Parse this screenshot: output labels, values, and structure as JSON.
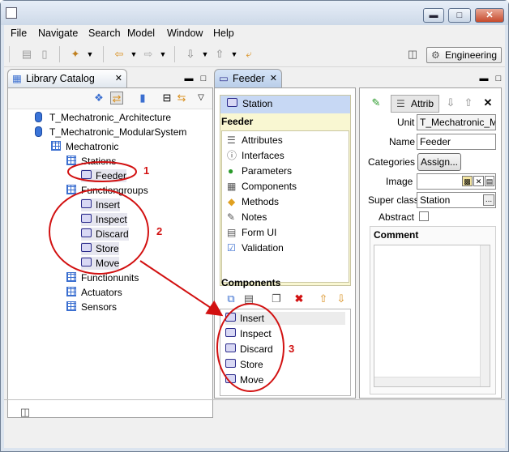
{
  "menu": [
    "File",
    "Navigate",
    "Search",
    "Model",
    "Window",
    "Help"
  ],
  "perspective": {
    "label": "Engineering"
  },
  "library": {
    "tab_label": "Library Catalog",
    "items": [
      {
        "label": "T_Mechatronic_Architecture"
      },
      {
        "label": "T_Mechatronic_ModularSystem"
      },
      {
        "label": "Mechatronic"
      },
      {
        "label": "Stations"
      },
      {
        "label": "Feeder"
      },
      {
        "label": "Functiongroups"
      },
      {
        "label": "Insert"
      },
      {
        "label": "Inspect"
      },
      {
        "label": "Discard"
      },
      {
        "label": "Store"
      },
      {
        "label": "Move"
      },
      {
        "label": "Functionunits"
      },
      {
        "label": "Actuators"
      },
      {
        "label": "Sensors"
      }
    ]
  },
  "editor": {
    "tab_label": "Feeder",
    "station_label": "Station",
    "heading": "Feeder",
    "nav": [
      "Attributes",
      "Interfaces",
      "Parameters",
      "Components",
      "Methods",
      "Notes",
      "Form UI",
      "Validation"
    ],
    "components_heading": "Components",
    "components": [
      "Insert",
      "Inspect",
      "Discard",
      "Store",
      "Move"
    ]
  },
  "attributes": {
    "tab_label": "Attrib",
    "unit_label": "Unit",
    "unit_value": "T_Mechatronic_M",
    "name_label": "Name",
    "name_value": "Feeder",
    "categories_label": "Categories",
    "assign_label": "Assign...",
    "image_label": "Image",
    "superclass_label": "Super class",
    "superclass_value": "Station",
    "abstract_label": "Abstract",
    "comment_label": "Comment",
    "browse_label": "..."
  },
  "annotations": [
    "1",
    "2",
    "3"
  ],
  "colors": {
    "annotation_red": "#d21111",
    "accent_blue": "#3b6fd0"
  }
}
